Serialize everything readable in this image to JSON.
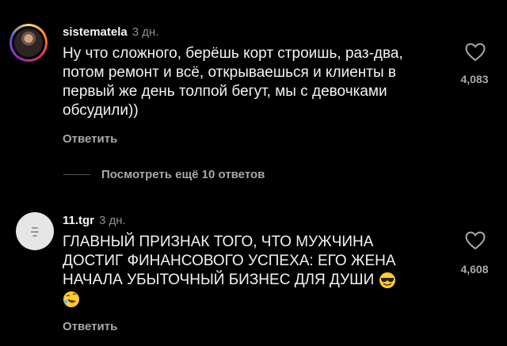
{
  "comments": [
    {
      "username": "sistematela",
      "time": "3 дн.",
      "text": "Ну что сложного, берёшь корт строишь, раз-два, потом ремонт и всё, открываешься и клиенты в первый же день толпой бегут, мы с девочками обсудили))",
      "likes": "4,083",
      "reply_label": "Ответить"
    },
    {
      "username": "11.tgr",
      "time": "3 дн.",
      "text": "ГЛАВНЫЙ ПРИЗНАК ТОГО, ЧТО МУЖЧИНА ДОСТИГ ФИНАНСОВОГО УСПЕХА: ЕГО ЖЕНА НАЧАЛА УБЫТОЧНЫЙ БИЗНЕС ДЛЯ ДУШИ",
      "likes": "4,608",
      "reply_label": "Ответить",
      "emojis": [
        "smiling-face-with-sunglasses",
        "rolling-on-the-floor-laughing"
      ]
    }
  ],
  "more_replies_label": "Посмотреть ещё 10 ответов",
  "colors": {
    "background": "#000000",
    "text": "#f2f2f2",
    "muted": "#a8a8a8"
  }
}
